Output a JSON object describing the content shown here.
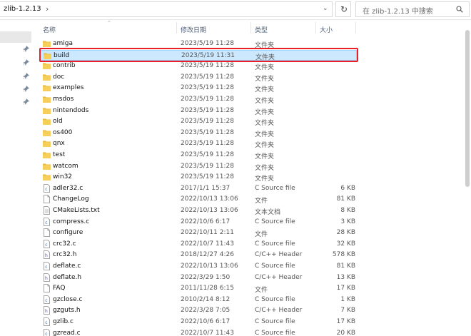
{
  "address": {
    "path": "zlib-1.2.13",
    "separator": "›"
  },
  "search": {
    "placeholder": "在 zlib-1.2.13 中搜索"
  },
  "columns": {
    "name": "名称",
    "date": "修改日期",
    "type": "类型",
    "size": "大小"
  },
  "colors": {
    "selection": "#cce8ff",
    "highlight": "#e8202a",
    "folder": "#f6cf5a"
  },
  "files": [
    {
      "name": "amiga",
      "date": "2023/5/19 11:28",
      "type": "文件夹",
      "size": "",
      "kind": "folder"
    },
    {
      "name": "build",
      "date": "2023/5/19 11:31",
      "type": "文件夹",
      "size": "",
      "kind": "folder",
      "selected": true
    },
    {
      "name": "contrib",
      "date": "2023/5/19 11:28",
      "type": "文件夹",
      "size": "",
      "kind": "folder"
    },
    {
      "name": "doc",
      "date": "2023/5/19 11:28",
      "type": "文件夹",
      "size": "",
      "kind": "folder"
    },
    {
      "name": "examples",
      "date": "2023/5/19 11:28",
      "type": "文件夹",
      "size": "",
      "kind": "folder"
    },
    {
      "name": "msdos",
      "date": "2023/5/19 11:28",
      "type": "文件夹",
      "size": "",
      "kind": "folder"
    },
    {
      "name": "nintendods",
      "date": "2023/5/19 11:28",
      "type": "文件夹",
      "size": "",
      "kind": "folder"
    },
    {
      "name": "old",
      "date": "2023/5/19 11:28",
      "type": "文件夹",
      "size": "",
      "kind": "folder"
    },
    {
      "name": "os400",
      "date": "2023/5/19 11:28",
      "type": "文件夹",
      "size": "",
      "kind": "folder"
    },
    {
      "name": "qnx",
      "date": "2023/5/19 11:28",
      "type": "文件夹",
      "size": "",
      "kind": "folder"
    },
    {
      "name": "test",
      "date": "2023/5/19 11:28",
      "type": "文件夹",
      "size": "",
      "kind": "folder"
    },
    {
      "name": "watcom",
      "date": "2023/5/19 11:28",
      "type": "文件夹",
      "size": "",
      "kind": "folder"
    },
    {
      "name": "win32",
      "date": "2023/5/19 11:28",
      "type": "文件夹",
      "size": "",
      "kind": "folder"
    },
    {
      "name": "adler32.c",
      "date": "2017/1/1 15:37",
      "type": "C Source file",
      "size": "6 KB",
      "kind": "c"
    },
    {
      "name": "ChangeLog",
      "date": "2022/10/13 13:06",
      "type": "文件",
      "size": "81 KB",
      "kind": "file"
    },
    {
      "name": "CMakeLists.txt",
      "date": "2022/10/13 13:06",
      "type": "文本文档",
      "size": "8 KB",
      "kind": "txt"
    },
    {
      "name": "compress.c",
      "date": "2022/10/6 6:17",
      "type": "C Source file",
      "size": "3 KB",
      "kind": "c"
    },
    {
      "name": "configure",
      "date": "2022/10/11 2:11",
      "type": "文件",
      "size": "28 KB",
      "kind": "file"
    },
    {
      "name": "crc32.c",
      "date": "2022/10/7 11:43",
      "type": "C Source file",
      "size": "32 KB",
      "kind": "c"
    },
    {
      "name": "crc32.h",
      "date": "2018/12/27 4:26",
      "type": "C/C++ Header",
      "size": "578 KB",
      "kind": "h"
    },
    {
      "name": "deflate.c",
      "date": "2022/10/13 13:06",
      "type": "C Source file",
      "size": "81 KB",
      "kind": "c"
    },
    {
      "name": "deflate.h",
      "date": "2022/3/29 1:50",
      "type": "C/C++ Header",
      "size": "13 KB",
      "kind": "h"
    },
    {
      "name": "FAQ",
      "date": "2011/11/28 6:15",
      "type": "文件",
      "size": "17 KB",
      "kind": "file"
    },
    {
      "name": "gzclose.c",
      "date": "2010/2/14 8:12",
      "type": "C Source file",
      "size": "1 KB",
      "kind": "c"
    },
    {
      "name": "gzguts.h",
      "date": "2022/3/28 7:05",
      "type": "C/C++ Header",
      "size": "7 KB",
      "kind": "h"
    },
    {
      "name": "gzlib.c",
      "date": "2022/10/6 6:17",
      "type": "C Source file",
      "size": "17 KB",
      "kind": "c"
    },
    {
      "name": "gzread.c",
      "date": "2022/10/7 11:43",
      "type": "C Source file",
      "size": "20 KB",
      "kind": "c"
    }
  ]
}
